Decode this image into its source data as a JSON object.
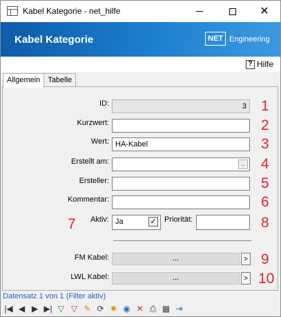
{
  "window": {
    "title": "Kabel Kategorie - net_hilfe",
    "icon": "table-icon"
  },
  "banner": {
    "title": "Kabel Kategorie",
    "logo_box": "NET",
    "logo_text": "Engineering"
  },
  "help": {
    "label": "Hilfe",
    "icon": "question-mark-icon"
  },
  "tabs": [
    {
      "label": "Allgemein",
      "active": true
    },
    {
      "label": "Tabelle",
      "active": false
    }
  ],
  "form": {
    "id": {
      "label": "ID:",
      "value": "3",
      "number": "1"
    },
    "kurzwert": {
      "label": "Kurzwert:",
      "value": "",
      "number": "2"
    },
    "wert": {
      "label": "Wert:",
      "value": "HA-Kabel",
      "number": "3"
    },
    "erstellt_am": {
      "label": "Erstellt am:",
      "value": "",
      "button": "..",
      "number": "4"
    },
    "ersteller": {
      "label": "Ersteller:",
      "value": "",
      "number": "5"
    },
    "kommentar": {
      "label": "Kommentar:",
      "value": "",
      "number": "6"
    },
    "aktiv": {
      "label": "Aktiv:",
      "value": "Ja",
      "checkmark": "✓",
      "number": "7"
    },
    "prioritaet": {
      "label": "Priorität:",
      "value": "",
      "number": "8"
    },
    "fm_kabel": {
      "label": "FM Kabel:",
      "value": "...",
      "arrow": ">",
      "number": "9"
    },
    "lwl_kabel": {
      "label": "LWL Kabel:",
      "value": "...",
      "arrow": ">",
      "number": "10"
    }
  },
  "status": {
    "record_text": "Datensatz 1 von 1 (Filter aktiv)"
  },
  "colors": {
    "banner_dark": "#0d5ca8",
    "banner_light": "#3d9ae0",
    "annotation_red": "#e0242a",
    "status_blue": "#1f5fcc"
  },
  "toolbar": {
    "buttons": [
      {
        "name": "first-record-icon",
        "glyph": "|◀"
      },
      {
        "name": "previous-record-icon",
        "glyph": "◀"
      },
      {
        "name": "next-record-icon",
        "glyph": "▶"
      },
      {
        "name": "last-record-icon",
        "glyph": "▶|"
      },
      {
        "name": "add-filter-icon",
        "glyph": "▽"
      },
      {
        "name": "remove-filter-icon",
        "glyph": "▽"
      },
      {
        "name": "edit-pencil-icon",
        "glyph": "✎"
      },
      {
        "name": "refresh-icon",
        "glyph": "⟳"
      },
      {
        "name": "new-record-sun-icon",
        "glyph": "✸"
      },
      {
        "name": "globe-refresh-icon",
        "glyph": "◉"
      },
      {
        "name": "delete-icon",
        "glyph": "✕"
      },
      {
        "name": "print-icon",
        "glyph": "⎙"
      },
      {
        "name": "table-view-icon",
        "glyph": "▦"
      },
      {
        "name": "exit-icon",
        "glyph": "⇥"
      }
    ]
  }
}
